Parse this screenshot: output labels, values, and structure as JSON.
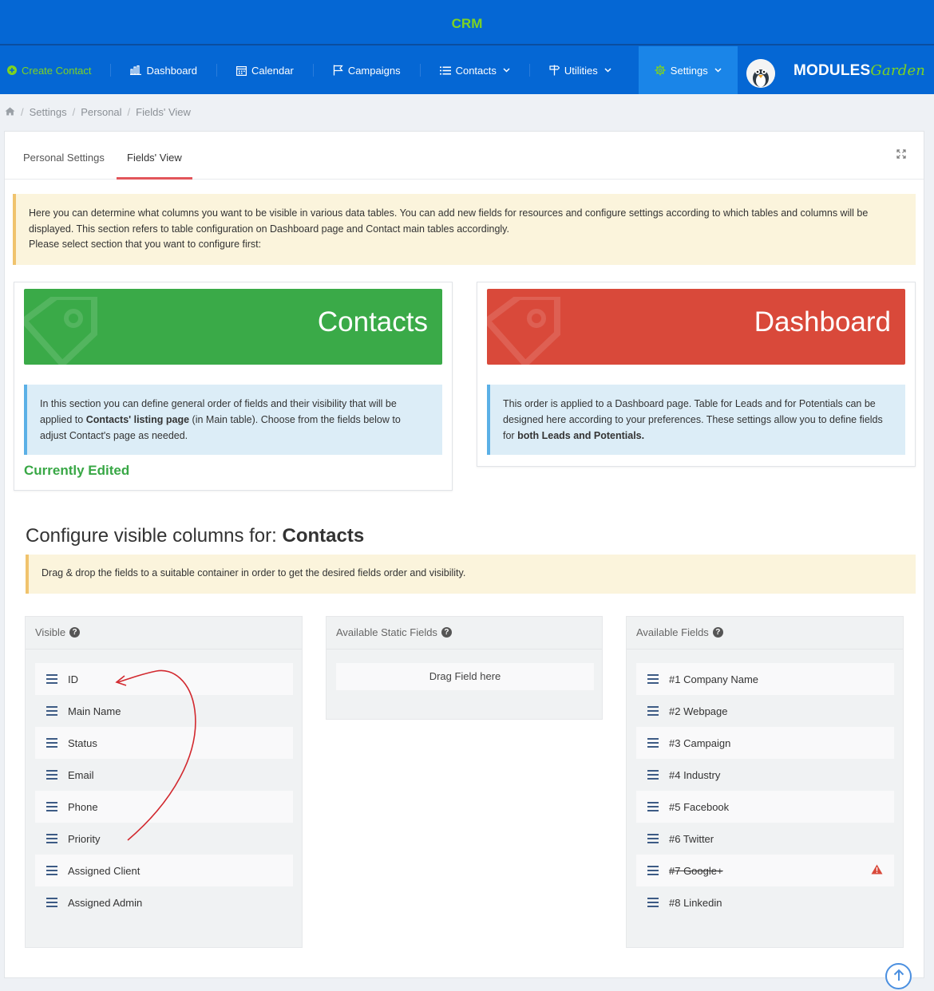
{
  "app": {
    "title": "CRM"
  },
  "nav": {
    "create_contact": "Create Contact",
    "dashboard": "Dashboard",
    "calendar": "Calendar",
    "campaigns": "Campaigns",
    "contacts": "Contacts",
    "utilities": "Utilities",
    "settings": "Settings"
  },
  "logo": {
    "modules": "MODULES",
    "garden": "Garden"
  },
  "breadcrumb": [
    "Settings",
    "Personal",
    "Fields' View"
  ],
  "tabs": [
    {
      "label": "Personal Settings",
      "active": false
    },
    {
      "label": "Fields' View",
      "active": true
    }
  ],
  "intro": {
    "line1": "Here you can determine what columns you want to be visible in various data tables. You can add new fields for resources and configure settings according to which tables and columns will be displayed. This section refers to table configuration on Dashboard page and Contact main tables accordingly.",
    "line2": "Please select section that you want to configure first:"
  },
  "sections": {
    "contacts": {
      "title": "Contacts",
      "desc_before": "In this section you can define general order of fields and their visibility that will be applied to ",
      "desc_bold": "Contacts' listing page",
      "desc_after": " (in Main table). Choose from the fields below to adjust Contact's page as needed.",
      "status": "Currently Edited",
      "color": "#3aaa48"
    },
    "dashboard": {
      "title": "Dashboard",
      "desc_before": "This order is applied to a Dashboard page. Table for Leads and for Potentials can be designed here according to your preferences. These settings allow you to define fields for ",
      "desc_bold": "both Leads and Potentials.",
      "color": "#d9493a"
    }
  },
  "configure": {
    "prefix": "Configure visible columns for:",
    "target": "Contacts",
    "hint": "Drag & drop the fields to a suitable container in order to get the desired fields order and visibility."
  },
  "columns": {
    "visible": {
      "title": "Visible",
      "items": [
        "ID",
        "Main Name",
        "Status",
        "Email",
        "Phone",
        "Priority",
        "Assigned Client",
        "Assigned Admin"
      ]
    },
    "static": {
      "title": "Available Static Fields",
      "placeholder": "Drag Field here"
    },
    "available": {
      "title": "Available Fields",
      "items": [
        "#1 Company Name",
        "#2 Webpage",
        "#3 Campaign",
        "#4 Industry",
        "#5 Facebook",
        "#6 Twitter",
        "#7 Google+",
        "#8 Linkedin"
      ],
      "deprecated_index": 6
    }
  },
  "colors": {
    "topbar": "#0567d4",
    "accent_green": "#7ed321",
    "tab_underline": "#e2555a",
    "warning": "#d9493a"
  }
}
